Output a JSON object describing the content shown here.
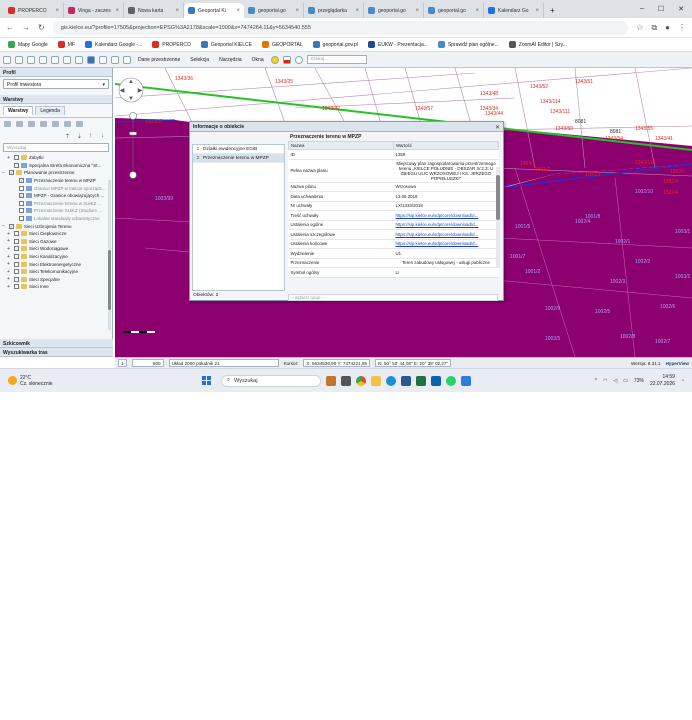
{
  "browser": {
    "tabs": [
      {
        "label": "PROPERCO",
        "color": "#d93025"
      },
      {
        "label": "Vinga - zaczes",
        "color": "#c6285b"
      },
      {
        "label": "Nowa karta",
        "color": "#5f6368"
      },
      {
        "label": "Geoportal Ki",
        "color": "#3b77bb",
        "active": true
      },
      {
        "label": "geoportal.go",
        "color": "#4a89c8"
      },
      {
        "label": "przeglądarka",
        "color": "#4a89c8"
      },
      {
        "label": "geoportal.go",
        "color": "#4a89c8"
      },
      {
        "label": "geoportal.go",
        "color": "#4a89c8"
      },
      {
        "label": "Kalendarz Go",
        "color": "#1a73e8"
      }
    ],
    "url": "gis.kielce.eu/?profile=17505&projection=EPSG%3A2178&scale=1000&x=7474264.11&y=5634540.555",
    "bookmarks": [
      "Mapy Google",
      "MF",
      "Kalendarz Google -...",
      "PROPERCO",
      "Geoportal KIELCE",
      "GEOPORTAL",
      "geoportal.gov.pl",
      "EUKW - Prezentacja...",
      "Sprawdź plan ogólne...",
      "ZoomAI Editor | Szy..."
    ]
  },
  "toolbar": {
    "menus": [
      "Dane przestrzenne",
      "Selekcja",
      "Narzędzia",
      "Okna"
    ],
    "search_placeholder": "Szukaj..."
  },
  "left": {
    "profile_header": "Profil",
    "profile_value": "Profil inwestora",
    "layers_header": "Warstwy",
    "tab_layers": "Warstwy",
    "tab_legend": "Legenda",
    "search_placeholder": "Wyszukaj",
    "tree": [
      {
        "label": "Zabytki",
        "indent": 1,
        "folder": true,
        "check": false,
        "exp": "+"
      },
      {
        "label": "Specjalna Strefa Ekonomiczna \"St...",
        "indent": 1,
        "folder": false,
        "check": false,
        "exp": ""
      },
      {
        "label": "Planowanie przestrzenne",
        "indent": 0,
        "folder": true,
        "check": true,
        "exp": "−"
      },
      {
        "label": "Przeznaczenie terenu w MPZP",
        "indent": 2,
        "folder": false,
        "check": true,
        "exp": ""
      },
      {
        "label": "Granice MPZP w trakcie sporządz...",
        "indent": 2,
        "folder": false,
        "check": false,
        "exp": ""
      },
      {
        "label": "MPZP - Granice obowiązujących ...",
        "indent": 2,
        "folder": false,
        "check": true,
        "exp": ""
      },
      {
        "label": "Przeznaczenie terenu w SUiKZ ...",
        "indent": 2,
        "folder": false,
        "check": false,
        "exp": ""
      },
      {
        "label": "Przeznaczenie SUiKZ (Studium ...",
        "indent": 2,
        "folder": false,
        "check": false,
        "exp": ""
      },
      {
        "label": "Lokalne standardy urbanistyczne",
        "indent": 2,
        "folder": false,
        "check": false,
        "exp": ""
      },
      {
        "label": "Sieci Uzbrojenia Terenu",
        "indent": 0,
        "folder": true,
        "check": true,
        "exp": "−"
      },
      {
        "label": "Sieci Ciepłownicze",
        "indent": 1,
        "folder": true,
        "check": false,
        "exp": "+"
      },
      {
        "label": "Sieci Gazowe",
        "indent": 1,
        "folder": true,
        "check": false,
        "exp": "+"
      },
      {
        "label": "Sieci Wodociągowe",
        "indent": 1,
        "folder": true,
        "check": false,
        "exp": "+"
      },
      {
        "label": "Sieci Kanalizacyjne",
        "indent": 1,
        "folder": true,
        "check": false,
        "exp": "+"
      },
      {
        "label": "Sieci Elektroenergetyczne",
        "indent": 1,
        "folder": true,
        "check": false,
        "exp": "+"
      },
      {
        "label": "Sieci Telekomunikacyjne",
        "indent": 1,
        "folder": true,
        "check": false,
        "exp": "+"
      },
      {
        "label": "Sieci Specjalne",
        "indent": 1,
        "folder": true,
        "check": false,
        "exp": "+"
      },
      {
        "label": "Sieci Inne",
        "indent": 1,
        "folder": true,
        "check": false,
        "exp": "+"
      }
    ],
    "bottom1": "Szkicownik",
    "bottom2": "Wyszukiwarka tras"
  },
  "dialog": {
    "title": "Informacje o obiekcie",
    "list": [
      {
        "n": "1",
        "label": "Działki ewidencyjne EGiB"
      },
      {
        "n": "2",
        "label": "Przeznaczenie terenu w MPZP"
      }
    ],
    "count": "Obiektów: 2",
    "right_title": "Przeznaczenie terenu w MPZP",
    "col_name": "Nazwa",
    "col_value": "Wartość",
    "rows": [
      {
        "k": "ID",
        "v": "1359"
      },
      {
        "k": "Pełna nazwa planu",
        "v": "Miejscowy plan zagospodarowania przestrzennego terenu „KIELCE POŁUDNIE - OBSZAR IV.2.3: U ZBIEGU ULIC WRZOSOWEJ I KS. JERZEGO POPIEŁUSZKI”",
        "wrap": true
      },
      {
        "k": "Nazwa planu",
        "v": "Wrzosowa"
      },
      {
        "k": "Data uchwalenia",
        "v": "13.09.2018"
      },
      {
        "k": "Nr uchwały",
        "v": "LX/1333/2018"
      },
      {
        "k": "Treść uchwały",
        "v": "https://sip.kielce.eu/sdp/core/download/d...",
        "link": true
      },
      {
        "k": "Ustalenia ogólne",
        "v": "https://sip.kielce.eu/sdp/core/download/d...",
        "link": true
      },
      {
        "k": "Ustalenia szczegółowe",
        "v": "https://sip.kielce.eu/sdp/core/download/d...",
        "link": true
      },
      {
        "k": "Ustalenia końcowe",
        "v": "https://sip.kielce.eu/sdp/core/download/d...",
        "link": true
      },
      {
        "k": "Wydzielenie",
        "v": "U1"
      },
      {
        "k": "Przeznaczenie",
        "v": "Teren zabudowy usługowej - usługi publiczne",
        "wrap": true
      },
      {
        "k": "Symbol ogólny",
        "v": "U"
      }
    ],
    "select_placeholder": "-- wybierz opcje --"
  },
  "map": {
    "parcels": [
      "1343/36",
      "1343/25",
      "1343/42",
      "1343/62",
      "1343/57",
      "1343/34",
      "1343/44",
      "1343/52",
      "1343/114",
      "1343/111",
      "1343/51",
      "1343/50",
      "1343/54",
      "1343/55",
      "1343/41",
      "1343/46",
      "8081",
      "8081",
      "1499/1",
      "1501/2",
      "1501/3",
      "1343/116",
      "1502/4",
      "1302/4",
      "1303/1",
      "1322/15",
      "1343/48"
    ],
    "mpzp_labels": [
      "1003/99",
      "1002/4",
      "1002/1",
      "1002/2",
      "1002/3",
      "1002/5",
      "1002/6",
      "1002/7",
      "1002/8",
      "1002/9",
      "1001/2",
      "1001/5",
      "1001/7",
      "1001/8",
      "1003/1",
      "1003/2",
      "1003/5",
      "1002/10"
    ],
    "colors": {
      "mpzp": "#8b006e",
      "road": "#22c322",
      "parcel_label": "#e8261b",
      "purple_label": "#a9a0ff"
    }
  },
  "status": {
    "page": "1",
    "scale": "500",
    "crs": "Układ 2000 południk 21",
    "kursor": "Kursor:",
    "xy": "X: 5634536,90  Y: 7474221,85",
    "ll": "N: 50° 50' 44,08\" E: 20° 38' 02,27\"",
    "version": "Wersja: 8.31.1",
    "brand": "HyperView"
  },
  "taskbar": {
    "temp": "22°C",
    "weather": "Cz. słonecznie",
    "search": "Wyszukaj",
    "battery": "73%",
    "time": "14:59",
    "date": "22.07.2026"
  }
}
